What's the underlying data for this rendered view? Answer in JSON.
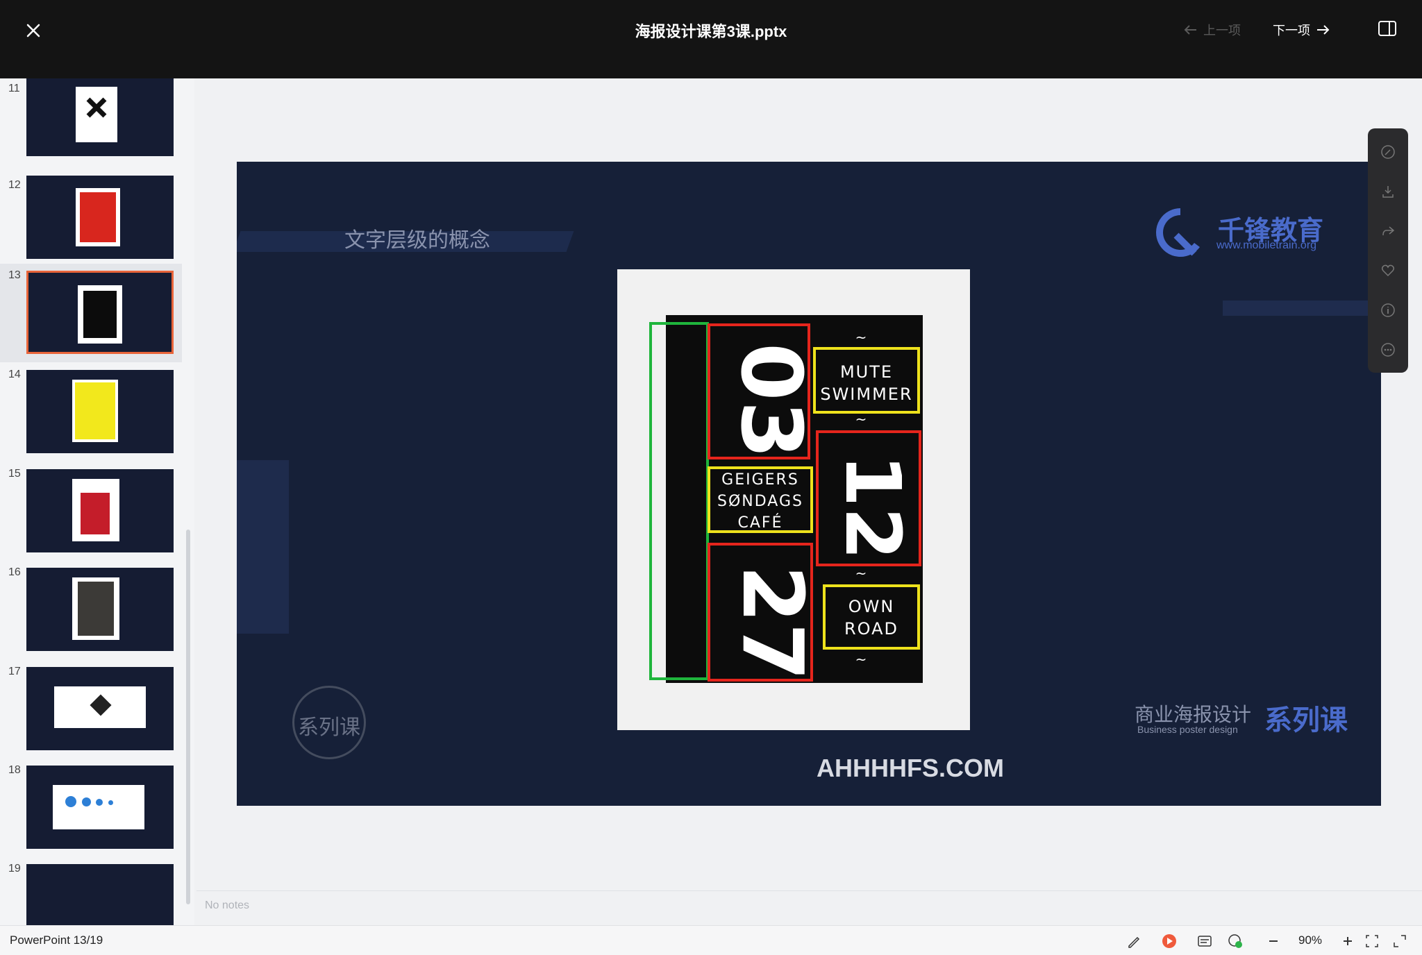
{
  "header": {
    "close_label": "close",
    "title": "海报设计课第3课.pptx",
    "prev_label": "上一项",
    "next_label": "下一项"
  },
  "thumbnails": [
    {
      "num": "11"
    },
    {
      "num": "12"
    },
    {
      "num": "13"
    },
    {
      "num": "14"
    },
    {
      "num": "15"
    },
    {
      "num": "16"
    },
    {
      "num": "17"
    },
    {
      "num": "18"
    },
    {
      "num": "19"
    }
  ],
  "slide": {
    "title": "文字层级的概念",
    "logo_name": "千锋教育",
    "logo_url": "www.mobiletrain.org",
    "series_left": "系列课",
    "series_right_title": "商业海报设计",
    "series_right_sub": "Business poster design",
    "series_right_blue": "系列课",
    "poster": {
      "num1": "03",
      "num2": "12",
      "num3": "27",
      "text1_line1": "MUTE",
      "text1_line2": "SWIMMER",
      "text2_line1": "GEIGERS",
      "text2_line2": "SØNDAGS",
      "text2_line3": "CAFÉ",
      "text3_line1": "OWN",
      "text3_line2": "ROAD",
      "tilde": "~"
    },
    "watermark": "AHHHHFS.COM"
  },
  "notes": {
    "placeholder": "No notes"
  },
  "status": {
    "app_position": "PowerPoint 13/19",
    "zoom": "90%"
  },
  "colors": {
    "accent": "#e8643a",
    "slide_bg": "#162038",
    "brand_blue": "#4a6bcb"
  }
}
